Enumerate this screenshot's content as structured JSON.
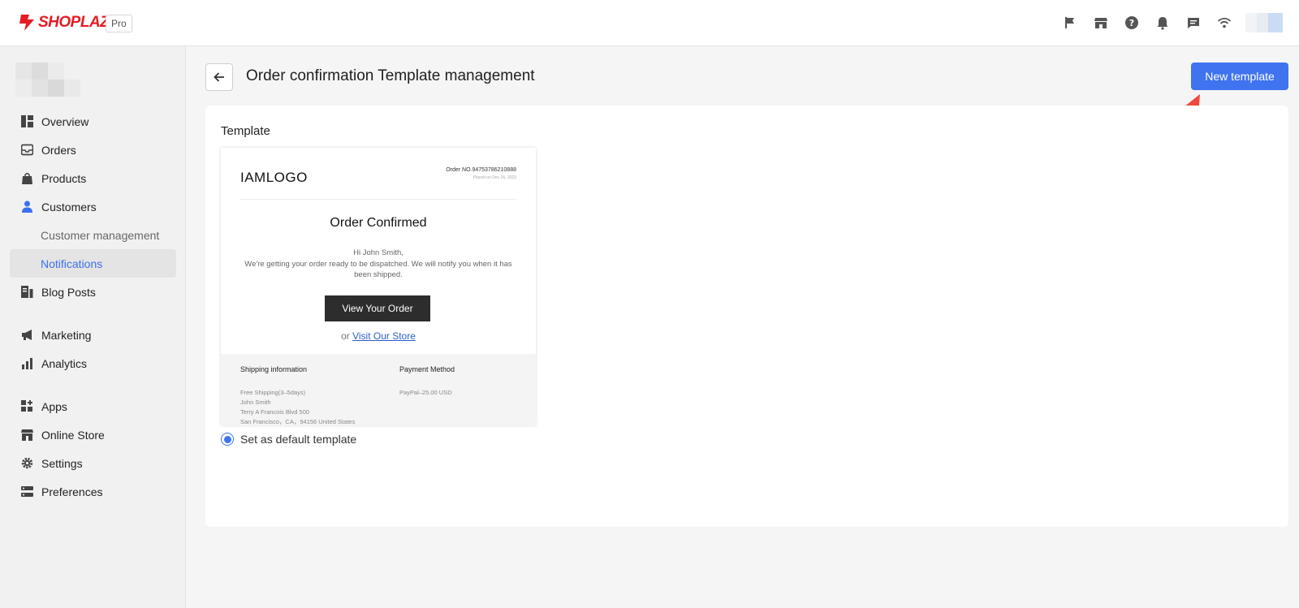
{
  "topbar": {
    "brand": "SHOPLAZZA",
    "plan_badge": "Pro",
    "icons": [
      "flag-icon",
      "store-icon",
      "help-icon",
      "bell-icon",
      "chat-icon",
      "wifi-icon"
    ],
    "brand_color": "#e51c23"
  },
  "sidebar": {
    "items": [
      {
        "label": "Overview",
        "icon": "overview-icon"
      },
      {
        "label": "Orders",
        "icon": "inbox-icon"
      },
      {
        "label": "Products",
        "icon": "bag-icon"
      },
      {
        "label": "Customers",
        "icon": "person-icon"
      },
      {
        "label": "Customer management"
      },
      {
        "label": "Notifications",
        "active": true
      },
      {
        "label": "Blog Posts",
        "icon": "blog-icon"
      },
      {
        "label": "Marketing",
        "icon": "megaphone-icon"
      },
      {
        "label": "Analytics",
        "icon": "bar-chart-icon"
      },
      {
        "label": "Apps",
        "icon": "apps-icon"
      },
      {
        "label": "Online Store",
        "icon": "store-icon"
      },
      {
        "label": "Settings",
        "icon": "gear-icon"
      },
      {
        "label": "Preferences",
        "icon": "preferences-icon"
      }
    ],
    "active_color": "#3b6ef0"
  },
  "header": {
    "title": "Order confirmation Template management",
    "new_button": "New template",
    "accent_color": "#3f73ef"
  },
  "card": {
    "label": "Template",
    "preview": {
      "logo": "IAMLOGO",
      "order_no": "Order NO.94753786210888",
      "placed_on": "Placed on Dec 26, 2023",
      "heading": "Order Confirmed",
      "greeting": "Hi  John Smith,",
      "message": "We're getting your order ready to be dispatched. We will notify you when it has been shipped.",
      "button": "View Your Order",
      "or_text": "or",
      "store_link": "Visit Our Store",
      "shipping_title": "Shipping information",
      "shipping_lines": [
        "Free Shipping(3–5days)",
        "John Smith",
        "Terry A Francois Blvd 500",
        "San Francisco，CA，94156 United States"
      ],
      "payment_title": "Payment Method",
      "payment_text": "PayPal–25.00 USD"
    },
    "default_label": "Set as default template",
    "default_selected": true
  }
}
